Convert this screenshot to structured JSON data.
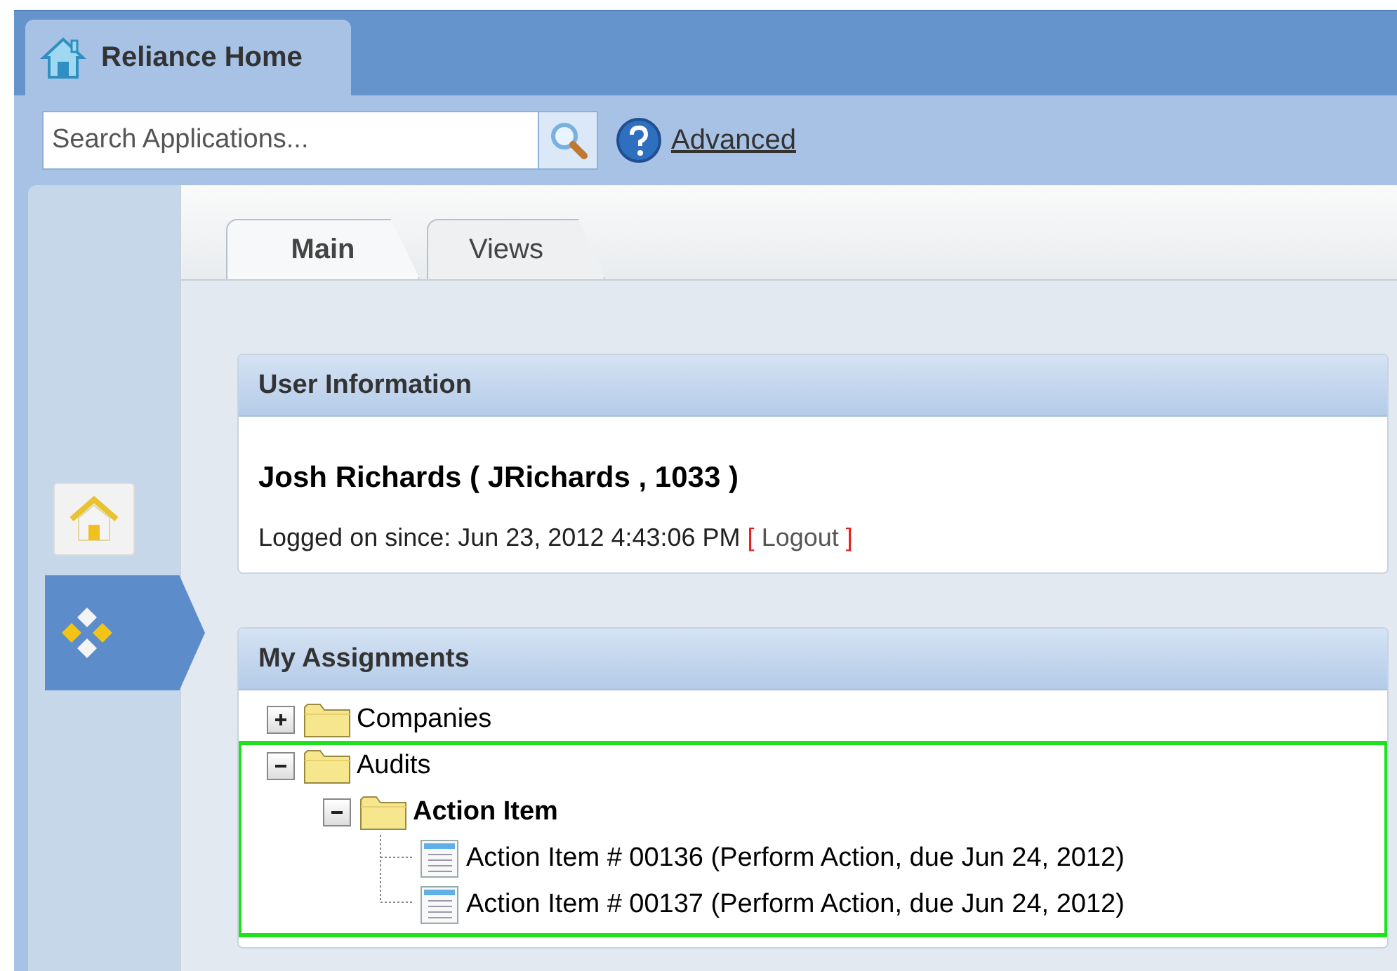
{
  "app_tab": {
    "title": "Reliance Home",
    "selected": true
  },
  "search": {
    "placeholder": "Search Applications..."
  },
  "advanced_link": "Advanced",
  "side_nav": [
    {
      "kind": "home",
      "selected": false
    },
    {
      "kind": "apps",
      "selected": true
    }
  ],
  "tabs": [
    {
      "label": "Main",
      "selected": true
    },
    {
      "label": "Views",
      "selected": false
    }
  ],
  "user_information": {
    "title": "User Information",
    "name": "Josh Richards ( JRichards , 1033 )",
    "logged_on": "Logged on since: Jun 23, 2012 4:43:06 PM",
    "logout_open": "[",
    "logout": "Logout",
    "logout_close": "]"
  },
  "my_assignments": {
    "title": "My Assignments",
    "nodes": [
      {
        "label": "Companies",
        "kind": "folder",
        "expanded": false,
        "selected": false,
        "highlighted": false
      },
      {
        "label": "Audits",
        "kind": "folder",
        "expanded": true,
        "selected": false,
        "highlighted": true,
        "children": [
          {
            "label": "Action Item",
            "kind": "folder",
            "expanded": true,
            "selected": true,
            "highlighted": false,
            "children": [
              {
                "label": "Action Item # 00136 (Perform Action, due Jun 24, 2012)",
                "kind": "document",
                "selected": false,
                "highlighted": false
              },
              {
                "label": "Action Item # 00137 (Perform Action, due Jun 24, 2012)",
                "kind": "document",
                "selected": false,
                "highlighted": false
              }
            ]
          }
        ]
      }
    ]
  }
}
